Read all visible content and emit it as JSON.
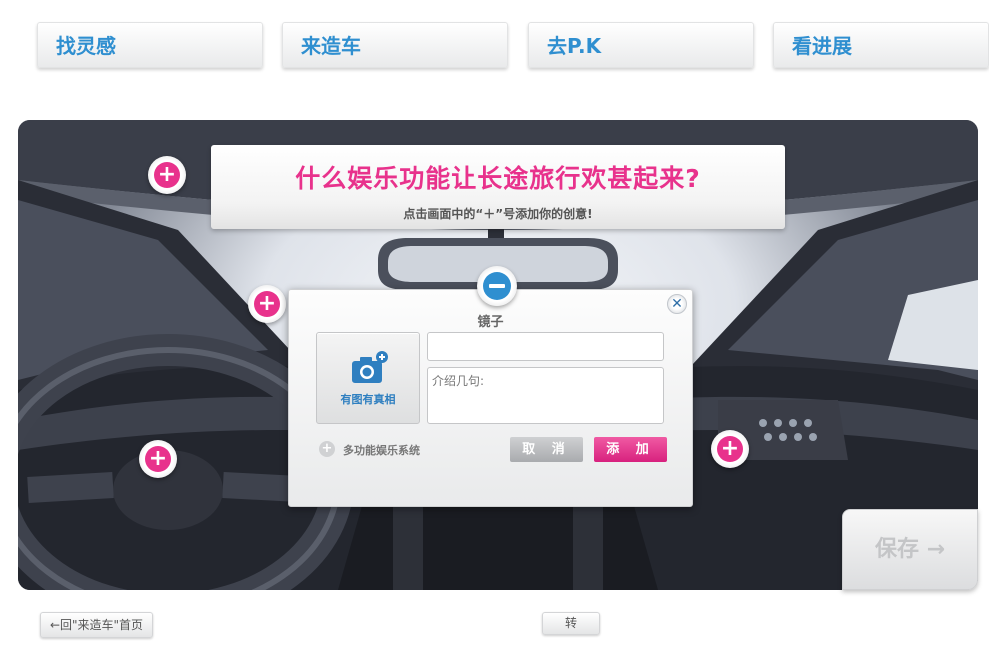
{
  "nav": {
    "tabs": [
      {
        "label": "找灵感"
      },
      {
        "label": "来造车"
      },
      {
        "label": "去P.K"
      },
      {
        "label": "看进展"
      }
    ]
  },
  "banner": {
    "title": "什么娱乐功能让长途旅行欢甚起来?",
    "subtitle": "点击画面中的“＋”号添加你的创意!"
  },
  "dialog": {
    "title": "镜子",
    "photo_label": "有图有真相",
    "name_value": "",
    "intro_placeholder": "介绍几句:",
    "category_label": "多功能娱乐系统",
    "cancel_label": "取 消",
    "add_label": "添 加",
    "close_glyph": "✕"
  },
  "save_label": "保存 →",
  "back_label": "←回\"来造车\"首页",
  "share_label": "转",
  "colors": {
    "accent_pink": "#e8328c",
    "accent_blue": "#2f8fd0"
  }
}
